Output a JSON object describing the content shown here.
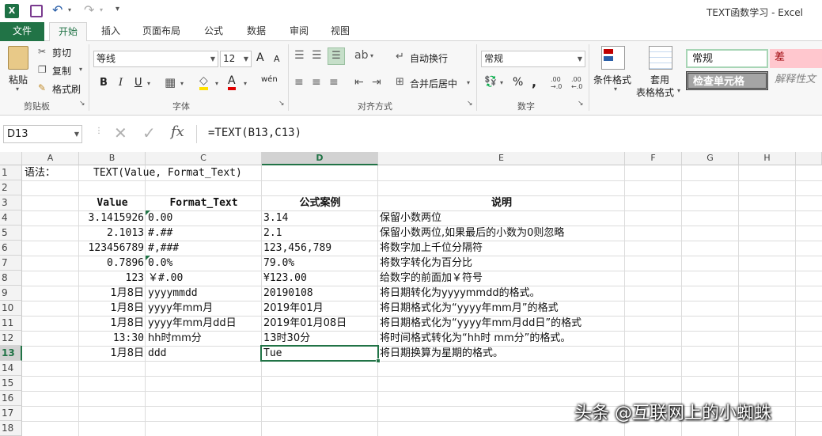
{
  "window": {
    "title": "TEXT函数学习 - Excel"
  },
  "tabs": [
    "文件",
    "开始",
    "插入",
    "页面布局",
    "公式",
    "数据",
    "审阅",
    "视图"
  ],
  "ribbon": {
    "clipboard": {
      "paste": "粘贴",
      "cut": "剪切",
      "copy": "复制",
      "format_painter": "格式刷",
      "label": "剪贴板"
    },
    "font": {
      "name": "等线",
      "size": "12",
      "grow": "A",
      "shrink": "A",
      "bold": "B",
      "italic": "I",
      "underline": "U",
      "phonetic": "wén",
      "label": "字体"
    },
    "alignment": {
      "wrap": "自动换行",
      "merge": "合并后居中",
      "label": "对齐方式"
    },
    "number": {
      "format": "常规",
      "percent": "%",
      "comma": ",",
      "label": "数字"
    },
    "styles": {
      "conditional": "条件格式",
      "table_line1": "套用",
      "table_line2": "表格格式",
      "normal": "常规",
      "bad": "差",
      "check_cell": "检查单元格",
      "explanatory": "解释性文"
    }
  },
  "formula_bar": {
    "name_box": "D13",
    "fx": "fx",
    "formula": "=TEXT(B13,C13)"
  },
  "columns": [
    "A",
    "B",
    "C",
    "D",
    "E",
    "F",
    "G",
    "H"
  ],
  "rows": [
    "1",
    "2",
    "3",
    "4",
    "5",
    "6",
    "7",
    "8",
    "9",
    "10",
    "11",
    "12",
    "13",
    "14",
    "15",
    "16",
    "17",
    "18"
  ],
  "sheet": {
    "a1": "语法：",
    "b1": "TEXT(Value, Format_Text)",
    "headers": {
      "value": "Value",
      "format": "Format_Text",
      "example": "公式案例",
      "desc": "说明"
    },
    "data_rows": [
      {
        "value": "3.1415926",
        "format": "0.00",
        "result": "3.14",
        "desc": "保留小数两位"
      },
      {
        "value": "2.1013",
        "format": "#.##",
        "result": "2.1",
        "desc": "保留小数两位,如果最后的小数为0则忽略"
      },
      {
        "value": "123456789",
        "format": "#,###",
        "result": "123,456,789",
        "desc": "将数字加上千位分隔符"
      },
      {
        "value": "0.7896",
        "format": "0.0%",
        "result": "79.0%",
        "desc": "将数字转化为百分比"
      },
      {
        "value": "123",
        "format": "￥#.00",
        "result": "¥123.00",
        "desc": "给数字的前面加￥符号"
      },
      {
        "value": "1月8日",
        "format": "yyyymmdd",
        "result": "20190108",
        "desc": "将日期转化为yyyymmdd的格式。"
      },
      {
        "value": "1月8日",
        "format": "yyyy年mm月",
        "result": "2019年01月",
        "desc": "将日期格式化为“yyyy年mm月”的格式"
      },
      {
        "value": "1月8日",
        "format": "yyyy年mm月dd日",
        "result": "2019年01月08日",
        "desc": "将日期格式化为“yyyy年mm月dd日”的格式"
      },
      {
        "value": "13:30",
        "format": "hh时mm分",
        "result": "13时30分",
        "desc": "将时间格式转化为“hh时 mm分”的格式。"
      },
      {
        "value": "1月8日",
        "format": "ddd",
        "result": "Tue",
        "desc": "将日期换算为星期的格式。"
      }
    ]
  },
  "watermark": "头条 @互联网上的小蜘蛛",
  "colors": {
    "excel_green": "#217346",
    "selection": "#217346"
  }
}
